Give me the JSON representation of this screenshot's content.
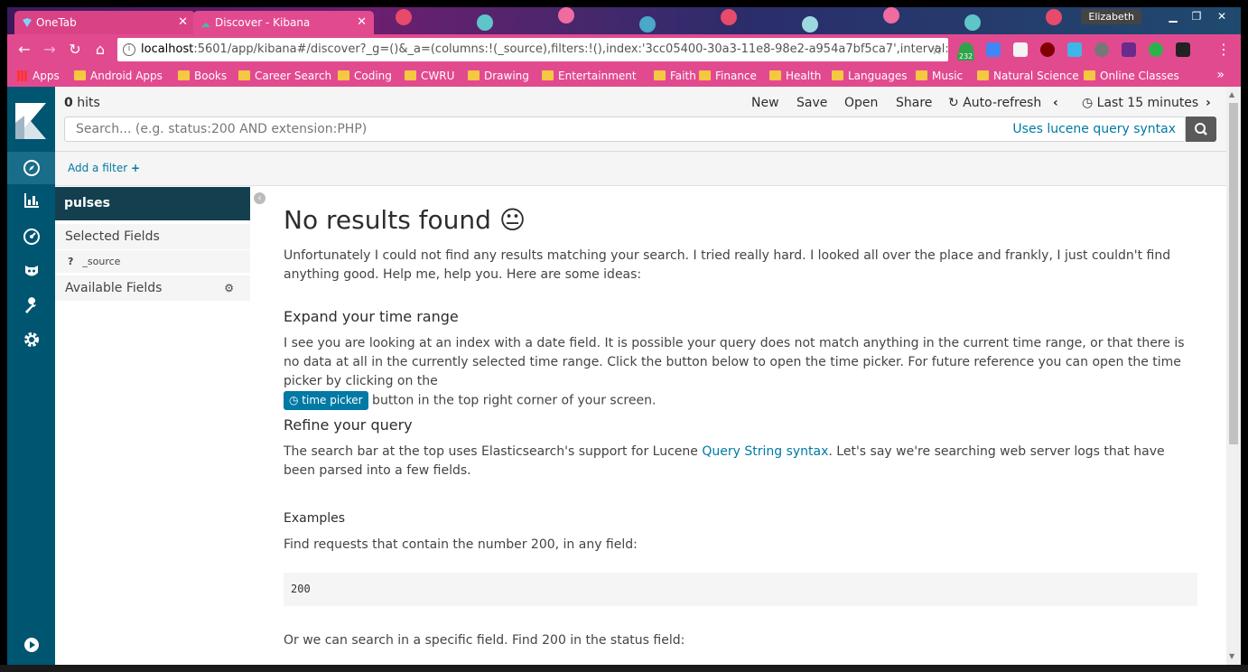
{
  "browser": {
    "tabs": [
      {
        "title": "OneTab"
      },
      {
        "title": "Discover - Kibana"
      }
    ],
    "user": "Elizabeth",
    "url": {
      "host": "localhost",
      "rest": ":5601/app/kibana#/discover?_g=()&_a=(columns:!(_source),filters:!(),index:'3cc05400-30a3-11e8-98e2-a954a7bf5ca7',interval:auto..."
    },
    "bookmarks": [
      {
        "label": "Apps"
      },
      {
        "label": "Android Apps"
      },
      {
        "label": "Books"
      },
      {
        "label": "Career Search"
      },
      {
        "label": "Coding"
      },
      {
        "label": "CWRU"
      },
      {
        "label": "Drawing"
      },
      {
        "label": "Entertainment"
      },
      {
        "label": "Faith"
      },
      {
        "label": "Finance"
      },
      {
        "label": "Health"
      },
      {
        "label": "Languages"
      },
      {
        "label": "Music"
      },
      {
        "label": "Natural Science"
      },
      {
        "label": "Online Classes"
      }
    ],
    "ext_badge": "232",
    "more": "»"
  },
  "kibana": {
    "hits_count": "0",
    "hits_label": " hits",
    "menu": {
      "new": "New",
      "save": "Save",
      "open": "Open",
      "share": "Share",
      "autorefresh": "Auto-refresh",
      "timerange": "Last 15 minutes"
    },
    "search": {
      "placeholder": "Search... (e.g. status:200 AND extension:PHP)",
      "lucene": "Uses lucene query syntax"
    },
    "add_filter": "Add a filter",
    "index_pattern": "pulses",
    "selected_fields": "Selected Fields",
    "field_type": "?",
    "field_name": "_source",
    "available_fields": "Available Fields",
    "content": {
      "title": "No results found",
      "emoji": "😐",
      "intro": "Unfortunately I could not find any results matching your search. I tried really hard. I looked all over the place and frankly, I just couldn't find anything good. Help me, help you. Here are some ideas:",
      "expand_title": "Expand your time range",
      "expand_text_1": "I see you are looking at an index with a date field. It is possible your query does not match anything in the current time range, or that there is no data at all in the currently selected time range. Click the button below to open the time picker. For future reference you can open the time picker by clicking on the",
      "time_picker_btn": "time picker",
      "expand_text_2": " button in the top right corner of your screen.",
      "refine_title": "Refine your query",
      "refine_text_1": "The search bar at the top uses Elasticsearch's support for Lucene ",
      "refine_link": "Query String syntax",
      "refine_text_2": ". Let's say we're searching web server logs that have been parsed into a few fields.",
      "examples_title": "Examples",
      "example1_text": "Find requests that contain the number 200, in any field:",
      "example1_code": "200",
      "example2_text": "Or we can search in a specific field. Find 200 in the status field:"
    }
  }
}
